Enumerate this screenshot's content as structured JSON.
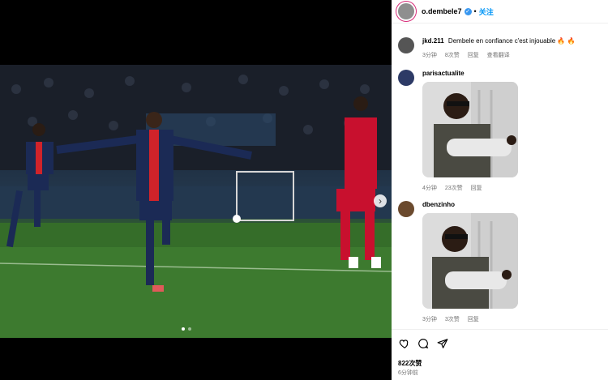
{
  "post": {
    "username": "o.dembele7",
    "follow_label": "关注",
    "separator": "•",
    "likes": "822次赞",
    "time": "6分钟前",
    "carousel_dots": 2,
    "carousel_active": 0
  },
  "comments": [
    {
      "user": "jkd.211",
      "text": "Dembele en confiance c'est injouable 🔥 🔥",
      "time": "3分钟",
      "likes": "8次赞",
      "reply": "回复",
      "translate": "查看翻译"
    },
    {
      "user": "parisactualite",
      "text": "",
      "time": "4分钟",
      "likes": "23次赞",
      "reply": "回复"
    },
    {
      "user": "dbenzinho",
      "text": "",
      "time": "3分钟",
      "likes": "3次赞",
      "reply": "回复"
    }
  ],
  "colors": {
    "follow_blue": "#0095f6",
    "meta_gray": "#737373",
    "psg_navy": "#1b2a55",
    "psg_red": "#d0232a",
    "opponent_red": "#c8102e"
  },
  "icons": [
    "verified-icon",
    "heart-icon",
    "comment-icon",
    "share-icon",
    "chevron-right-icon"
  ]
}
